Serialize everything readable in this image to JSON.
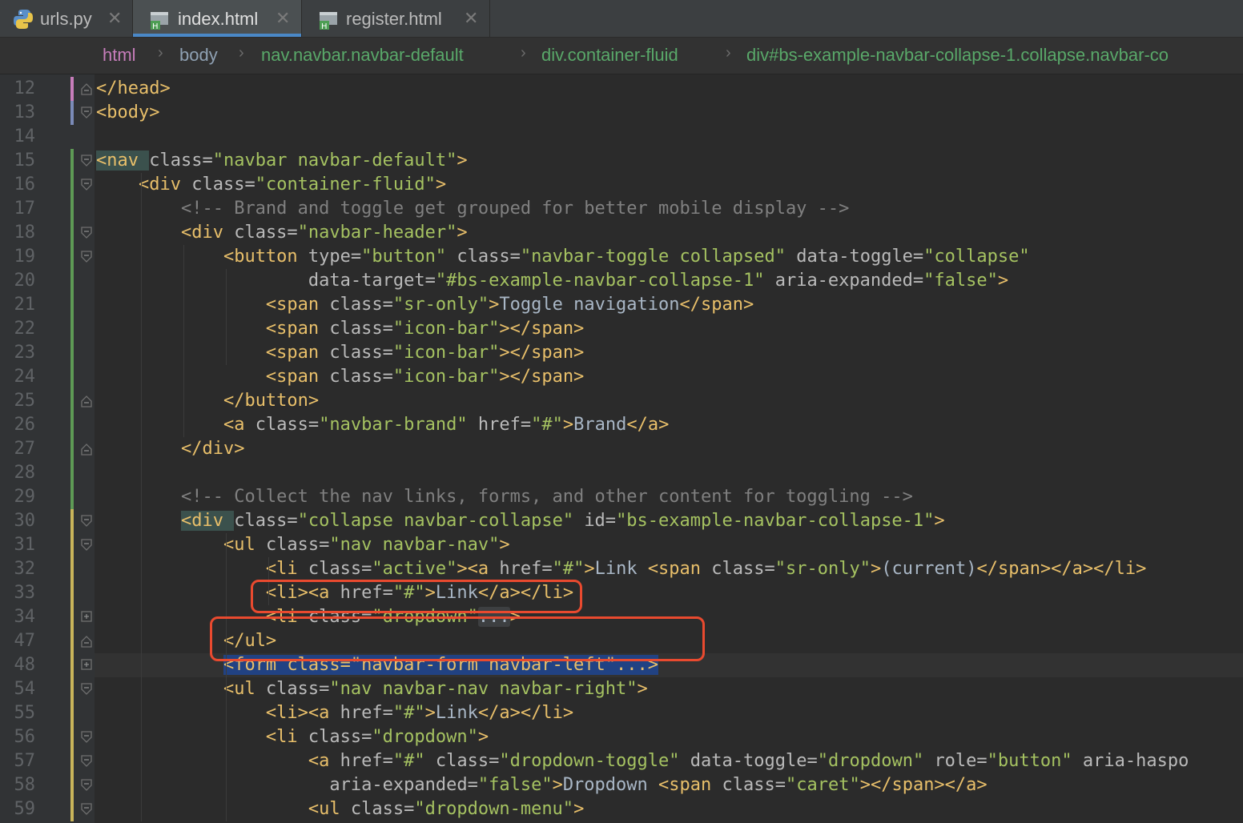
{
  "tabs": [
    {
      "label": "urls.py",
      "icon": "python-file-icon",
      "active": false
    },
    {
      "label": "index.html",
      "icon": "html-file-icon",
      "active": true
    },
    {
      "label": "register.html",
      "icon": "html-file-icon",
      "active": false
    }
  ],
  "breadcrumb": [
    {
      "label": "html",
      "color": "#c77dbb"
    },
    {
      "label": "body",
      "color": "#8fa1b3"
    },
    {
      "label": "nav.navbar.navbar-default",
      "color": "#59a869"
    },
    {
      "label": "div.container-fluid",
      "color": "#59a869"
    },
    {
      "label": "div#bs-example-navbar-collapse-1.collapse.navbar-co",
      "color": "#59a869"
    }
  ],
  "lines": [
    {
      "n": "12",
      "segs": [
        [
          "tg",
          "</head>"
        ]
      ]
    },
    {
      "n": "13",
      "segs": [
        [
          "tg",
          "<body>"
        ]
      ]
    },
    {
      "n": "14",
      "segs": []
    },
    {
      "n": "15",
      "segs": [
        [
          "tg",
          "<nav "
        ],
        [
          "at",
          "class="
        ],
        [
          "vl",
          "\"navbar navbar-default\""
        ],
        [
          "tg",
          ">"
        ]
      ]
    },
    {
      "n": "16",
      "segs": [
        [
          "tx",
          "    "
        ],
        [
          "tg",
          "<div "
        ],
        [
          "at",
          "class="
        ],
        [
          "vl",
          "\"container-fluid\""
        ],
        [
          "tg",
          ">"
        ]
      ]
    },
    {
      "n": "17",
      "segs": [
        [
          "tx",
          "        "
        ],
        [
          "cm",
          "<!-- Brand and toggle get grouped for better mobile display -->"
        ]
      ]
    },
    {
      "n": "18",
      "segs": [
        [
          "tx",
          "        "
        ],
        [
          "tg",
          "<div "
        ],
        [
          "at",
          "class="
        ],
        [
          "vl",
          "\"navbar-header\""
        ],
        [
          "tg",
          ">"
        ]
      ]
    },
    {
      "n": "19",
      "segs": [
        [
          "tx",
          "            "
        ],
        [
          "tg",
          "<button "
        ],
        [
          "at",
          "type="
        ],
        [
          "vl",
          "\"button\" "
        ],
        [
          "at",
          "class="
        ],
        [
          "vl",
          "\"navbar-toggle collapsed\" "
        ],
        [
          "at",
          "data-toggle="
        ],
        [
          "vl",
          "\"collapse\""
        ]
      ]
    },
    {
      "n": "20",
      "segs": [
        [
          "tx",
          "                    "
        ],
        [
          "at",
          "data-target="
        ],
        [
          "vl",
          "\"#bs-example-navbar-collapse-1\" "
        ],
        [
          "at",
          "aria-expanded="
        ],
        [
          "vl",
          "\"false\""
        ],
        [
          "tg",
          ">"
        ]
      ]
    },
    {
      "n": "21",
      "segs": [
        [
          "tx",
          "                "
        ],
        [
          "tg",
          "<span "
        ],
        [
          "at",
          "class="
        ],
        [
          "vl",
          "\"sr-only\""
        ],
        [
          "tg",
          ">"
        ],
        [
          "tx",
          "Toggle navigation"
        ],
        [
          "tg",
          "</span>"
        ]
      ]
    },
    {
      "n": "22",
      "segs": [
        [
          "tx",
          "                "
        ],
        [
          "tg",
          "<span "
        ],
        [
          "at",
          "class="
        ],
        [
          "vl",
          "\"icon-bar\""
        ],
        [
          "tg",
          "></span>"
        ]
      ]
    },
    {
      "n": "23",
      "segs": [
        [
          "tx",
          "                "
        ],
        [
          "tg",
          "<span "
        ],
        [
          "at",
          "class="
        ],
        [
          "vl",
          "\"icon-bar\""
        ],
        [
          "tg",
          "></span>"
        ]
      ]
    },
    {
      "n": "24",
      "segs": [
        [
          "tx",
          "                "
        ],
        [
          "tg",
          "<span "
        ],
        [
          "at",
          "class="
        ],
        [
          "vl",
          "\"icon-bar\""
        ],
        [
          "tg",
          "></span>"
        ]
      ]
    },
    {
      "n": "25",
      "segs": [
        [
          "tx",
          "            "
        ],
        [
          "tg",
          "</button>"
        ]
      ]
    },
    {
      "n": "26",
      "segs": [
        [
          "tx",
          "            "
        ],
        [
          "tg",
          "<a "
        ],
        [
          "at",
          "class="
        ],
        [
          "vl",
          "\"navbar-brand\" "
        ],
        [
          "at",
          "href="
        ],
        [
          "vl",
          "\"#\""
        ],
        [
          "tg",
          ">"
        ],
        [
          "tx",
          "Brand"
        ],
        [
          "tg",
          "</a>"
        ]
      ]
    },
    {
      "n": "27",
      "segs": [
        [
          "tx",
          "        "
        ],
        [
          "tg",
          "</div>"
        ]
      ]
    },
    {
      "n": "28",
      "segs": []
    },
    {
      "n": "29",
      "segs": [
        [
          "tx",
          "        "
        ],
        [
          "cm",
          "<!-- Collect the nav links, forms, and other content for toggling -->"
        ]
      ]
    },
    {
      "n": "30",
      "segs": [
        [
          "tx",
          "        "
        ],
        [
          "tg",
          "<div "
        ],
        [
          "at",
          "class="
        ],
        [
          "vl",
          "\"collapse navbar-collapse\" "
        ],
        [
          "at",
          "id="
        ],
        [
          "vl",
          "\"bs-example-navbar-collapse-1\""
        ],
        [
          "tg",
          ">"
        ]
      ]
    },
    {
      "n": "31",
      "segs": [
        [
          "tx",
          "            "
        ],
        [
          "tg",
          "<ul "
        ],
        [
          "at",
          "class="
        ],
        [
          "vl",
          "\"nav navbar-nav\""
        ],
        [
          "tg",
          ">"
        ]
      ]
    },
    {
      "n": "32",
      "segs": [
        [
          "tx",
          "                "
        ],
        [
          "tg",
          "<li "
        ],
        [
          "at",
          "class="
        ],
        [
          "vl",
          "\"active\""
        ],
        [
          "tg",
          "><a "
        ],
        [
          "at",
          "href="
        ],
        [
          "vl",
          "\"#\""
        ],
        [
          "tg",
          ">"
        ],
        [
          "tx",
          "Link "
        ],
        [
          "tg",
          "<span "
        ],
        [
          "at",
          "class="
        ],
        [
          "vl",
          "\"sr-only\""
        ],
        [
          "tg",
          ">"
        ],
        [
          "tx",
          "(current)"
        ],
        [
          "tg",
          "</span></a></li>"
        ]
      ]
    },
    {
      "n": "33",
      "segs": [
        [
          "tx",
          "                "
        ],
        [
          "tg",
          "<li><a "
        ],
        [
          "at",
          "href="
        ],
        [
          "vl",
          "\"#\""
        ],
        [
          "tg",
          ">"
        ],
        [
          "tx",
          "Link"
        ],
        [
          "tg",
          "</a></li>"
        ]
      ]
    },
    {
      "n": "34",
      "segs": [
        [
          "tx",
          "                "
        ],
        [
          "tg",
          "<li "
        ],
        [
          "at",
          "class="
        ],
        [
          "vl",
          "\"dropdown\""
        ],
        [
          "dots",
          "..."
        ],
        [
          "tg",
          ">"
        ]
      ]
    },
    {
      "n": "47",
      "segs": [
        [
          "tx",
          "            "
        ],
        [
          "tg",
          "</ul>"
        ]
      ]
    },
    {
      "n": "48",
      "segs": [
        [
          "tx",
          "            "
        ],
        [
          "sel",
          "<form class=\"navbar-form navbar-left\"...>"
        ]
      ]
    },
    {
      "n": "54",
      "segs": [
        [
          "tx",
          "            "
        ],
        [
          "tg",
          "<ul "
        ],
        [
          "at",
          "class="
        ],
        [
          "vl",
          "\"nav navbar-nav navbar-right\""
        ],
        [
          "tg",
          ">"
        ]
      ]
    },
    {
      "n": "55",
      "segs": [
        [
          "tx",
          "                "
        ],
        [
          "tg",
          "<li><a "
        ],
        [
          "at",
          "href="
        ],
        [
          "vl",
          "\"#\""
        ],
        [
          "tg",
          ">"
        ],
        [
          "tx",
          "Link"
        ],
        [
          "tg",
          "</a></li>"
        ]
      ]
    },
    {
      "n": "56",
      "segs": [
        [
          "tx",
          "                "
        ],
        [
          "tg",
          "<li "
        ],
        [
          "at",
          "class="
        ],
        [
          "vl",
          "\"dropdown\""
        ],
        [
          "tg",
          ">"
        ]
      ]
    },
    {
      "n": "57",
      "segs": [
        [
          "tx",
          "                    "
        ],
        [
          "tg",
          "<a "
        ],
        [
          "at",
          "href="
        ],
        [
          "vl",
          "\"#\" "
        ],
        [
          "at",
          "class="
        ],
        [
          "vl",
          "\"dropdown-toggle\" "
        ],
        [
          "at",
          "data-toggle="
        ],
        [
          "vl",
          "\"dropdown\" "
        ],
        [
          "at",
          "role="
        ],
        [
          "vl",
          "\"button\" "
        ],
        [
          "at",
          "aria-haspo"
        ]
      ]
    },
    {
      "n": "58",
      "segs": [
        [
          "tx",
          "                      "
        ],
        [
          "at",
          "aria-expanded="
        ],
        [
          "vl",
          "\"false\""
        ],
        [
          "tg",
          ">"
        ],
        [
          "tx",
          "Dropdown "
        ],
        [
          "tg",
          "<span "
        ],
        [
          "at",
          "class="
        ],
        [
          "vl",
          "\"caret\""
        ],
        [
          "tg",
          "></span></a>"
        ]
      ]
    },
    {
      "n": "59",
      "segs": [
        [
          "tx",
          "                    "
        ],
        [
          "tg",
          "<ul "
        ],
        [
          "at",
          "class="
        ],
        [
          "vl",
          "\"dropdown-menu\""
        ],
        [
          "tg",
          ">"
        ]
      ]
    }
  ]
}
